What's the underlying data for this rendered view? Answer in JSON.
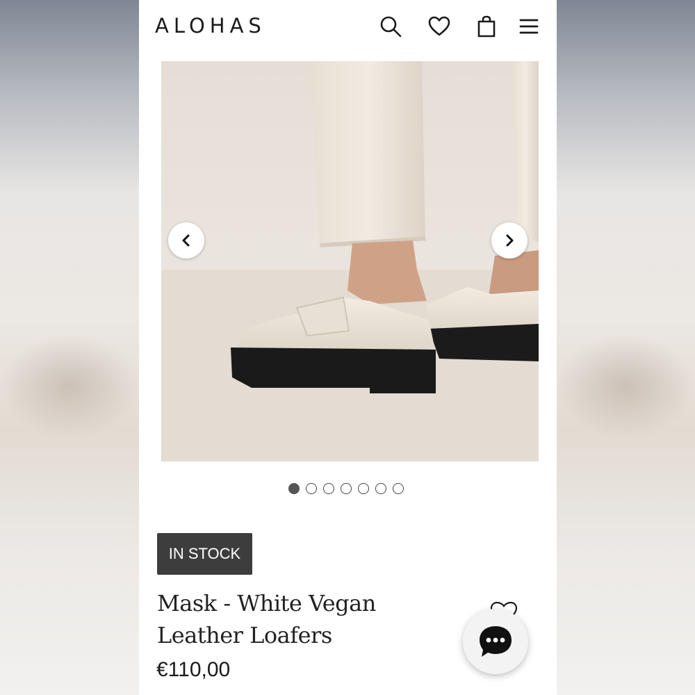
{
  "header": {
    "logo": "ALOHAS",
    "icons": [
      "search-icon",
      "heart-icon",
      "bag-icon",
      "menu-icon"
    ]
  },
  "gallery": {
    "image_count": 7,
    "active_index": 0,
    "prev_icon": "chevron-left-icon",
    "next_icon": "chevron-right-icon"
  },
  "product": {
    "stock_badge": "IN STOCK",
    "title": "Mask - White Vegan Leather Loafers",
    "price": "€110,00",
    "wishlist_icon": "heart-outline-icon"
  },
  "chat": {
    "icon": "chat-bubble-icon"
  },
  "colors": {
    "badge_bg": "#3d3d3d",
    "text": "#1a1a1a",
    "page_bg": "#ffffff"
  }
}
